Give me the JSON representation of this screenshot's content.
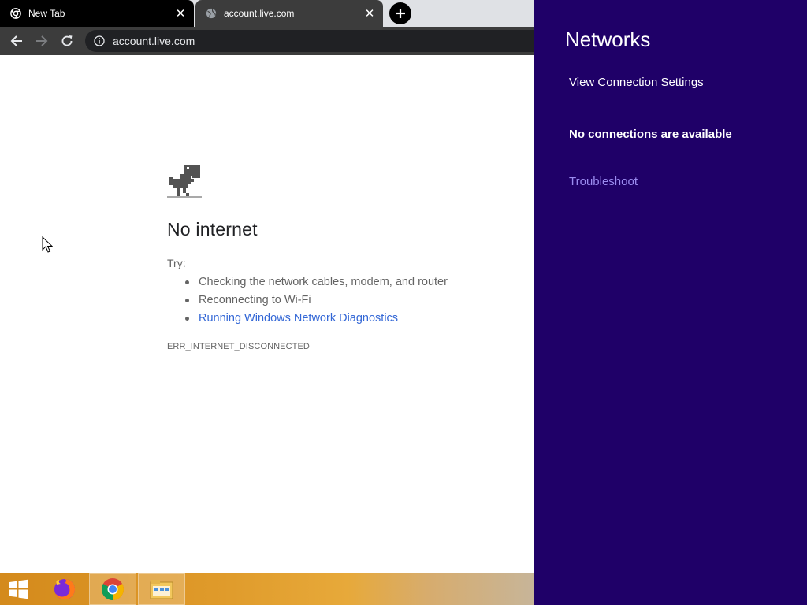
{
  "browser": {
    "tabs": [
      {
        "title": "New Tab",
        "active": true,
        "icon": "chrome-icon"
      },
      {
        "title": "account.live.com",
        "active": false,
        "icon": "globe-icon"
      }
    ],
    "url": "account.live.com"
  },
  "error_page": {
    "title": "No internet",
    "try_label": "Try:",
    "suggestions": [
      "Checking the network cables, modem, and router",
      "Reconnecting to Wi-Fi",
      "Running Windows Network Diagnostics"
    ],
    "error_code": "ERR_INTERNET_DISCONNECTED"
  },
  "charm": {
    "title": "Networks",
    "view_settings": "View Connection Settings",
    "status": "No connections are available",
    "troubleshoot": "Troubleshoot"
  },
  "taskbar": {
    "items": [
      "windows-start-icon",
      "firefox-icon",
      "chrome-icon",
      "file-explorer-icon"
    ]
  },
  "colors": {
    "charm_bg": "#1f0068",
    "link": "#3367d6",
    "troubleshoot_link": "#9b8cf0",
    "taskbar": "#df9a2a"
  }
}
